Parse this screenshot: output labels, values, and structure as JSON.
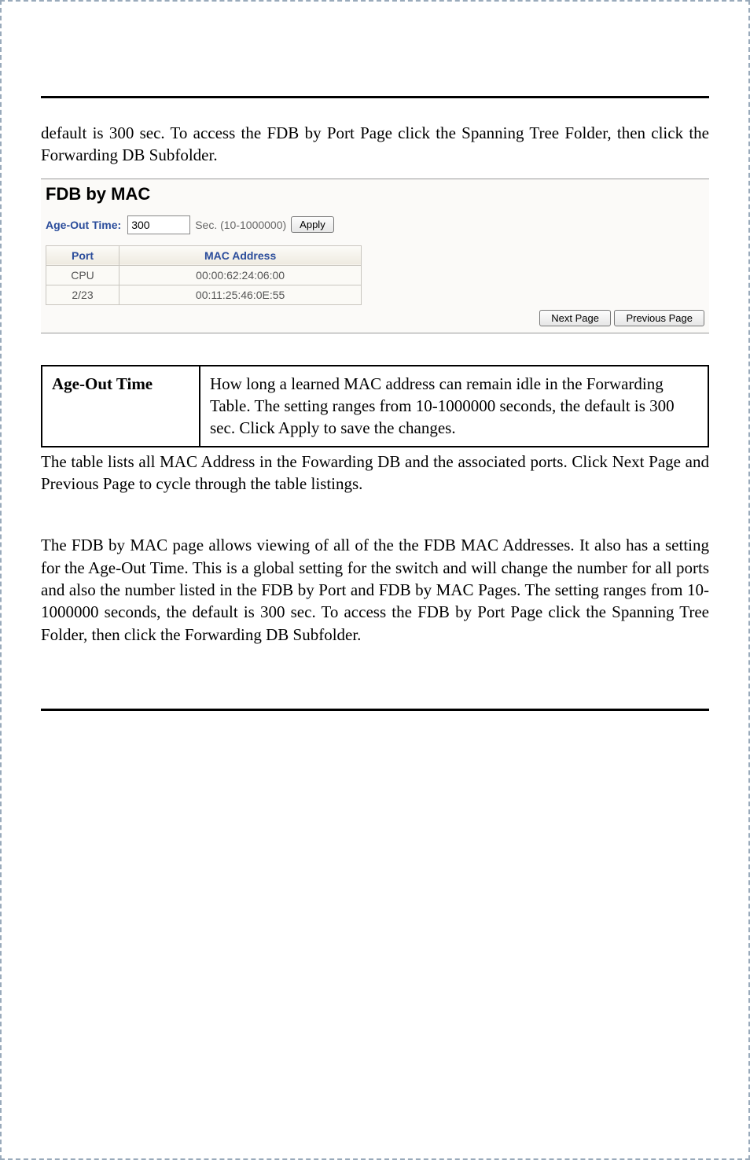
{
  "intro_paragraph": "default is 300 sec. To access the FDB by Port Page click the Spanning Tree Folder, then click the Forwarding DB Subfolder.",
  "fdb_panel": {
    "title": "FDB by MAC",
    "age_out_label": "Age-Out Time:",
    "age_out_value": "300",
    "age_out_hint": "Sec. (10-1000000)",
    "apply_label": "Apply",
    "columns": {
      "port": "Port",
      "mac": "MAC Address"
    },
    "rows": [
      {
        "port": "CPU",
        "mac": "00:00:62:24:06:00"
      },
      {
        "port": "2/23",
        "mac": "00:11:25:46:0E:55"
      }
    ],
    "next_label": "Next Page",
    "prev_label": "Previous Page"
  },
  "field_table": {
    "name": "Age-Out Time",
    "desc": "How long a learned MAC address can remain idle in the Forwarding Table. The setting ranges from 10-1000000 seconds, the default is 300 sec. Click Apply to save the changes."
  },
  "after_table_paragraph": "The table lists all MAC Address in the Fowarding DB and the associated ports. Click Next Page and Previous Page to cycle through the table listings.",
  "final_paragraph": "The FDB by MAC page allows viewing of all of the the FDB MAC Addresses.  It also has a setting for the Age-Out Time. This is a global setting for the switch and will change the number for all ports and also the number listed in the FDB by Port and FDB by MAC Pages. The setting ranges from 10-1000000 seconds, the default is 300 sec. To access the FDB by Port Page click the Spanning Tree Folder, then click the Forwarding DB Subfolder."
}
